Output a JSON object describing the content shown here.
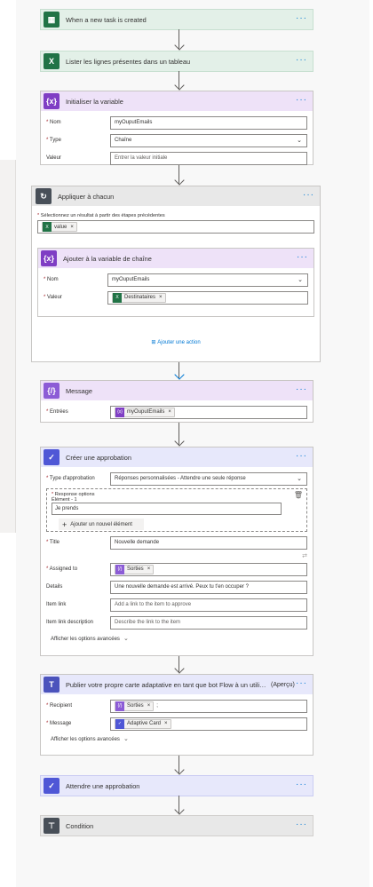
{
  "colors": {
    "trigger": "#217346",
    "excel": "#217346",
    "variable": "#7f3ec4",
    "loop": "#484f58",
    "approval": "#4f57d6",
    "teams": "#4b53bc",
    "condition": "#484f58",
    "link": "#0078d4"
  },
  "trigger": {
    "title": "When a new task is created",
    "icon": "planner-icon",
    "more": "···"
  },
  "list_rows": {
    "title": "Lister les lignes présentes dans un tableau",
    "icon": "excel-icon",
    "more": "···"
  },
  "init_var": {
    "title": "Initialiser la variable",
    "icon": "variable-icon",
    "more": "···",
    "name_label": "Nom",
    "name_value": "myOuputEmails",
    "type_label": "Type",
    "type_value": "Chaîne",
    "value_label": "Valeur",
    "value_placeholder": "Entrer la valeur initiale"
  },
  "apply_each": {
    "title": "Appliquer à chacun",
    "icon": "loop-icon",
    "more": "···",
    "select_label": "Sélectionnez un résultat à partir des étapes précédentes",
    "token": "value",
    "append": {
      "title": "Ajouter à la variable de chaîne",
      "more": "···",
      "name_label": "Nom",
      "name_value": "myOuputEmails",
      "value_label": "Valeur",
      "value_token": "Destinataires"
    },
    "add_action": "Ajouter une action"
  },
  "message": {
    "title": "Message",
    "more": "···",
    "inputs_label": "Entrées",
    "inputs_token": "myOuputEmails"
  },
  "approval": {
    "title": "Créer une approbation",
    "more": "···",
    "type_label": "Type d'approbation",
    "type_value": "Réponses personnalisées - Attendre une seule réponse",
    "options_label": "Response options Élément - 1",
    "option_value": "Je prends",
    "add_item": "Ajouter un nouvel élément",
    "title_label": "Title",
    "title_value": "Nouvelle demande",
    "assigned_label": "Assigned to",
    "assigned_token": "Sorties",
    "details_label": "Details",
    "details_value": "Une nouvelle demande est arrivé. Peux tu t'en occuper ?",
    "item_link_label": "Item link",
    "item_link_placeholder": "Add a link to the item to approve",
    "item_link_desc_label": "Item link description",
    "item_link_desc_placeholder": "Describe the link to the item",
    "advanced": "Afficher les options avancées"
  },
  "teams": {
    "title": "Publier votre propre carte adaptative en tant que bot Flow à un utilisa...",
    "preview": "(Aperçu)",
    "more": "···",
    "recipient_label": "Recipient",
    "recipient_token": "Sorties",
    "recipient_suffix": ";",
    "message_label": "Message",
    "message_token": "Adaptive Card",
    "advanced": "Afficher les options avancées"
  },
  "wait": {
    "title": "Attendre une approbation",
    "more": "···"
  },
  "condition": {
    "title": "Condition",
    "more": "···"
  }
}
